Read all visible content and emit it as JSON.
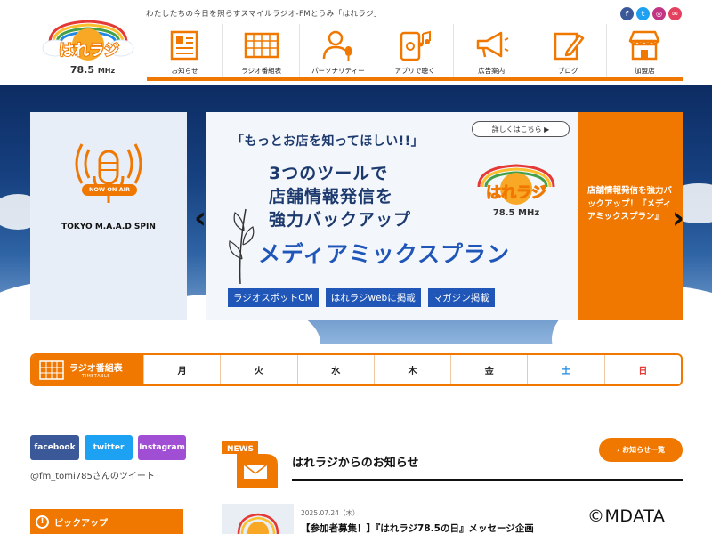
{
  "header": {
    "tagline": "わたしたちの今日を照らすスマイルラジオ-FMとうみ「はれラジ」",
    "logo_text": "はれラジ",
    "logo_freq": "78.5",
    "logo_unit": "MHz",
    "social_icons": [
      "facebook-icon",
      "twitter-icon",
      "instagram-icon",
      "mail-icon"
    ],
    "social_colors": [
      "#3b5998",
      "#1da1f2",
      "#c13584",
      "#e4405f"
    ]
  },
  "nav": [
    {
      "label": "お知らせ",
      "icon": "newspaper-icon"
    },
    {
      "label": "ラジオ番組表",
      "icon": "timetable-icon"
    },
    {
      "label": "パーソナリティー",
      "icon": "personality-icon"
    },
    {
      "label": "アプリで聴く",
      "icon": "phone-music-icon"
    },
    {
      "label": "広告案内",
      "icon": "megaphone-icon"
    },
    {
      "label": "ブログ",
      "icon": "blog-pen-icon"
    },
    {
      "label": "加盟店",
      "icon": "store-icon"
    }
  ],
  "hero": {
    "now_on_air_badge": "NOW ON AIR",
    "now_program": "TOKYO M.A.A.D SPIN",
    "banner_title": "「もっとお店を知ってほしい!!」",
    "banner_detail_button": "詳しくはこちら ▶",
    "banner_line1": "3つのツールで",
    "banner_line2": "店舗情報発信を",
    "banner_line3": "強力バックアップ",
    "banner_main": "メディアミックスプラン",
    "banner_tags": [
      "ラジオスポットCM",
      "はれラジwebに掲載",
      "マガジン掲載"
    ],
    "side_promo": "店舗情報発信を強力バックアップ！『メディアミックスプラン』",
    "prev_arrow": "‹",
    "next_arrow": "›"
  },
  "timetable": {
    "title": "ラジオ番組表",
    "subtitle": "TIMETABLE",
    "days": [
      "月",
      "火",
      "水",
      "木",
      "金",
      "土",
      "日"
    ],
    "day_colors": [
      "#111",
      "#111",
      "#111",
      "#111",
      "#111",
      "#1e88e5",
      "#e53935"
    ]
  },
  "sidebar": {
    "social_buttons": [
      {
        "label": "facebook",
        "color": "#3b5998"
      },
      {
        "label": "twitter",
        "color": "#1da1f2"
      },
      {
        "label": "Instagram",
        "color": "#a04ed3"
      }
    ],
    "tweet_text": "@fm_tomi785さんのツイート",
    "pickup_label": "ピックアップ",
    "pickup_icon": "!"
  },
  "news": {
    "badge": "NEWS",
    "title": "はれラジからのお知らせ",
    "list_button": "› お知らせ一覧",
    "items": [
      {
        "date": "2025.07.24（木）",
        "title": "【参加者募集！】『はれラジ78.5の日』メッセージ企画"
      }
    ]
  },
  "watermark": "©MDATA",
  "colors": {
    "accent": "#f07800",
    "navy": "#1d3a6e",
    "banner_blue": "#1f56b8"
  }
}
